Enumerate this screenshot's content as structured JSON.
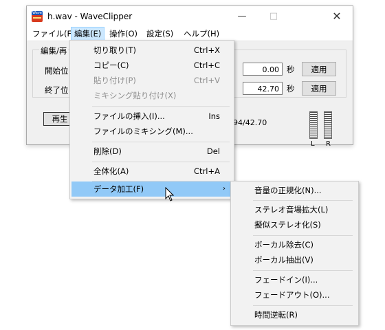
{
  "window": {
    "icon_text": "Wave",
    "title": "h.wav - WaveClipper",
    "controls": {
      "minimize": "—",
      "maximize": "□",
      "close": "✕"
    }
  },
  "menubar": [
    "ファイル(F)",
    "編集(E)",
    "操作(O)",
    "設定(S)",
    "ヘルプ(H)"
  ],
  "main": {
    "group_label": "編集/再",
    "start_label": "開始位",
    "end_label": "終了位",
    "start_value": "0.00",
    "end_value": "42.70",
    "unit": "秒",
    "apply_label": "適用",
    "play_label": "再生",
    "time_display": "94/42.70",
    "meter_left": "L",
    "meter_right": "R"
  },
  "edit_menu": {
    "items": [
      {
        "label": "切り取り(T)",
        "shortcut": "Ctrl+X"
      },
      {
        "label": "コピー(C)",
        "shortcut": "Ctrl+C"
      },
      {
        "label": "貼り付け(P)",
        "shortcut": "Ctrl+V"
      },
      {
        "label": "ミキシング貼り付け(X)",
        "shortcut": ""
      },
      {
        "label": "ファイルの挿入(I)...",
        "shortcut": "Ins"
      },
      {
        "label": "ファイルのミキシング(M)...",
        "shortcut": ""
      },
      {
        "label": "削除(D)",
        "shortcut": "Del"
      },
      {
        "label": "全体化(A)",
        "shortcut": "Ctrl+A"
      },
      {
        "label": "データ加工(F)",
        "shortcut": "",
        "submenu_arrow": "›"
      }
    ]
  },
  "data_submenu": {
    "items": [
      "音量の正規化(N)...",
      "ステレオ音場拡大(L)",
      "擬似ステレオ化(S)",
      "ボーカル除去(C)",
      "ボーカル抽出(V)",
      "フェードイン(I)...",
      "フェードアウト(O)...",
      "時間逆転(R)"
    ]
  },
  "colors": {
    "highlight": "#91c9f7",
    "menubar_active": "#cce8ff",
    "disabled_text": "#8e8e8e",
    "icon_top": "#1a56b8",
    "icon_bottom": "#d83b1f"
  },
  "icons": [
    "app-wave-icon",
    "submenu-arrow-icon",
    "mouse-cursor-icon"
  ]
}
